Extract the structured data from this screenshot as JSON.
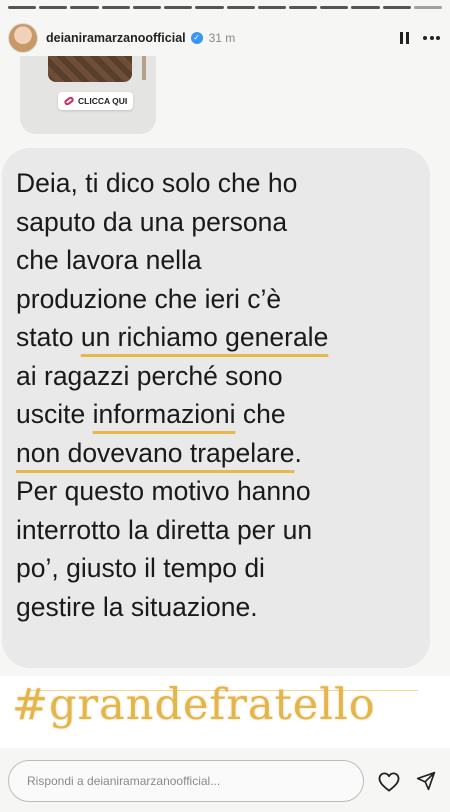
{
  "story": {
    "username": "deianiramarzanoofficial",
    "time_ago": "31 m",
    "segments_total": 14,
    "segments_done": 13
  },
  "sticker": {
    "link_label": "CLICCA QUI"
  },
  "message": {
    "lines": [
      "Deia, ti dico solo che ho",
      "saputo da una persona",
      "che lavora nella",
      "produzione che ieri c’è",
      "stato un richiamo generale",
      "ai ragazzi perché sono",
      "uscite informazioni che",
      "non dovevano trapelare.",
      "Per questo motivo hanno",
      "interrotto la diretta per un",
      "po’, giusto il tempo di",
      "gestire la situazione."
    ],
    "l5_pre": "stato ",
    "l5_hl": "un richiamo generale",
    "l7_pre": "uscite ",
    "l7_hl": "informazioni",
    "l7_post": " che",
    "l8_hl": "non dovevano trapelare",
    "l8_post": "."
  },
  "hashtag": "#grandefratello",
  "reply": {
    "placeholder": "Rispondi a deianiramarzanoofficial..."
  },
  "colors": {
    "highlight": "#e8b84a",
    "hashtag": "#e4b64a",
    "verified": "#3897f0"
  },
  "icons": [
    "verified-badge-icon",
    "pause-icon",
    "more-options-icon",
    "link-icon",
    "heart-icon",
    "send-icon"
  ]
}
